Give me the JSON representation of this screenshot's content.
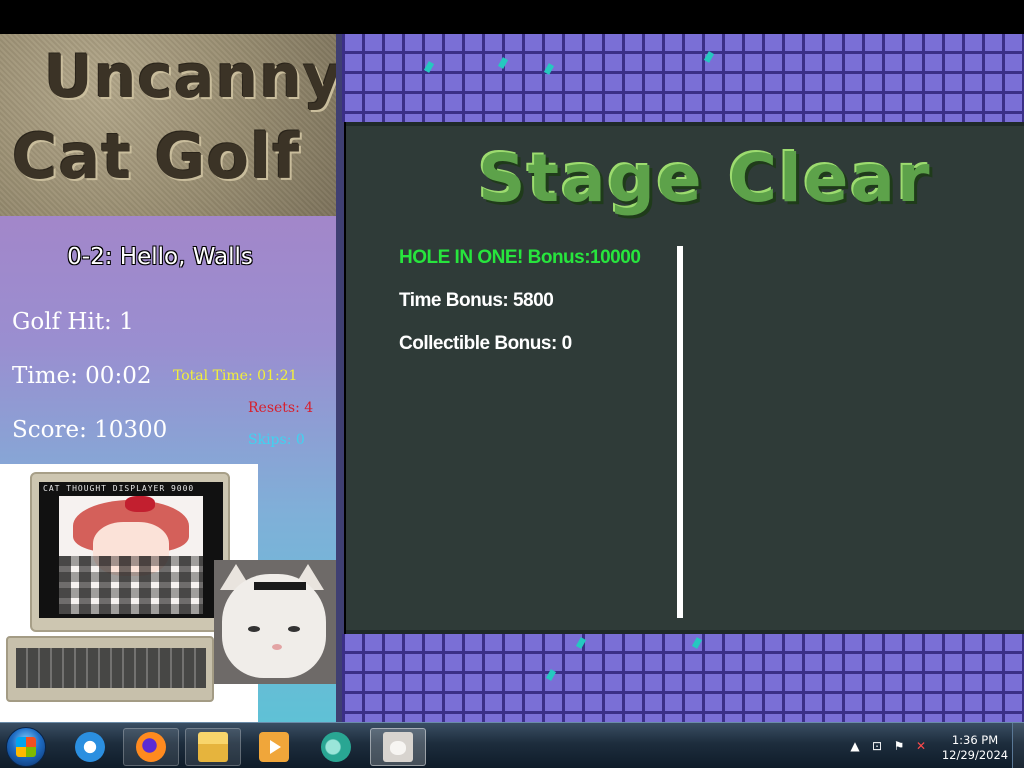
{
  "game": {
    "logo": {
      "line1": "Uncanny",
      "line2": "Cat Golf"
    },
    "level_title": "0-2: Hello, Walls",
    "golf_hit": "Golf Hit: 1",
    "time": "Time: 00:02",
    "total_time": "Total Time: 01:21",
    "resets": "Resets: 4",
    "score": "Score: 10300",
    "skips": "Skips: 0",
    "computer_caption": "CAT THOUGHT DISPLAYER 9000"
  },
  "stage_clear": {
    "title": "Stage Clear",
    "hole_in_one": "HOLE IN ONE! Bonus:10000",
    "time_bonus": "Time Bonus: 5800",
    "collectible_bonus": "Collectible Bonus: 0"
  },
  "colors": {
    "hole_in_one": "#27e53d",
    "total_time": "#f2ef3a",
    "resets": "#d81f2c",
    "skips": "#3fd3f0",
    "panel": "#2f3b38",
    "tiles": "#7a6fd6"
  },
  "taskbar": {
    "items": [
      {
        "icon": "internet-explorer-icon"
      },
      {
        "icon": "firefox-icon"
      },
      {
        "icon": "windows-explorer-icon"
      },
      {
        "icon": "media-player-icon"
      },
      {
        "icon": "fish-app-icon"
      },
      {
        "icon": "cat-window-icon",
        "active": true
      }
    ],
    "tray_arrow": "▲",
    "clock_time": "1:36 PM",
    "clock_date": "12/29/2024"
  }
}
